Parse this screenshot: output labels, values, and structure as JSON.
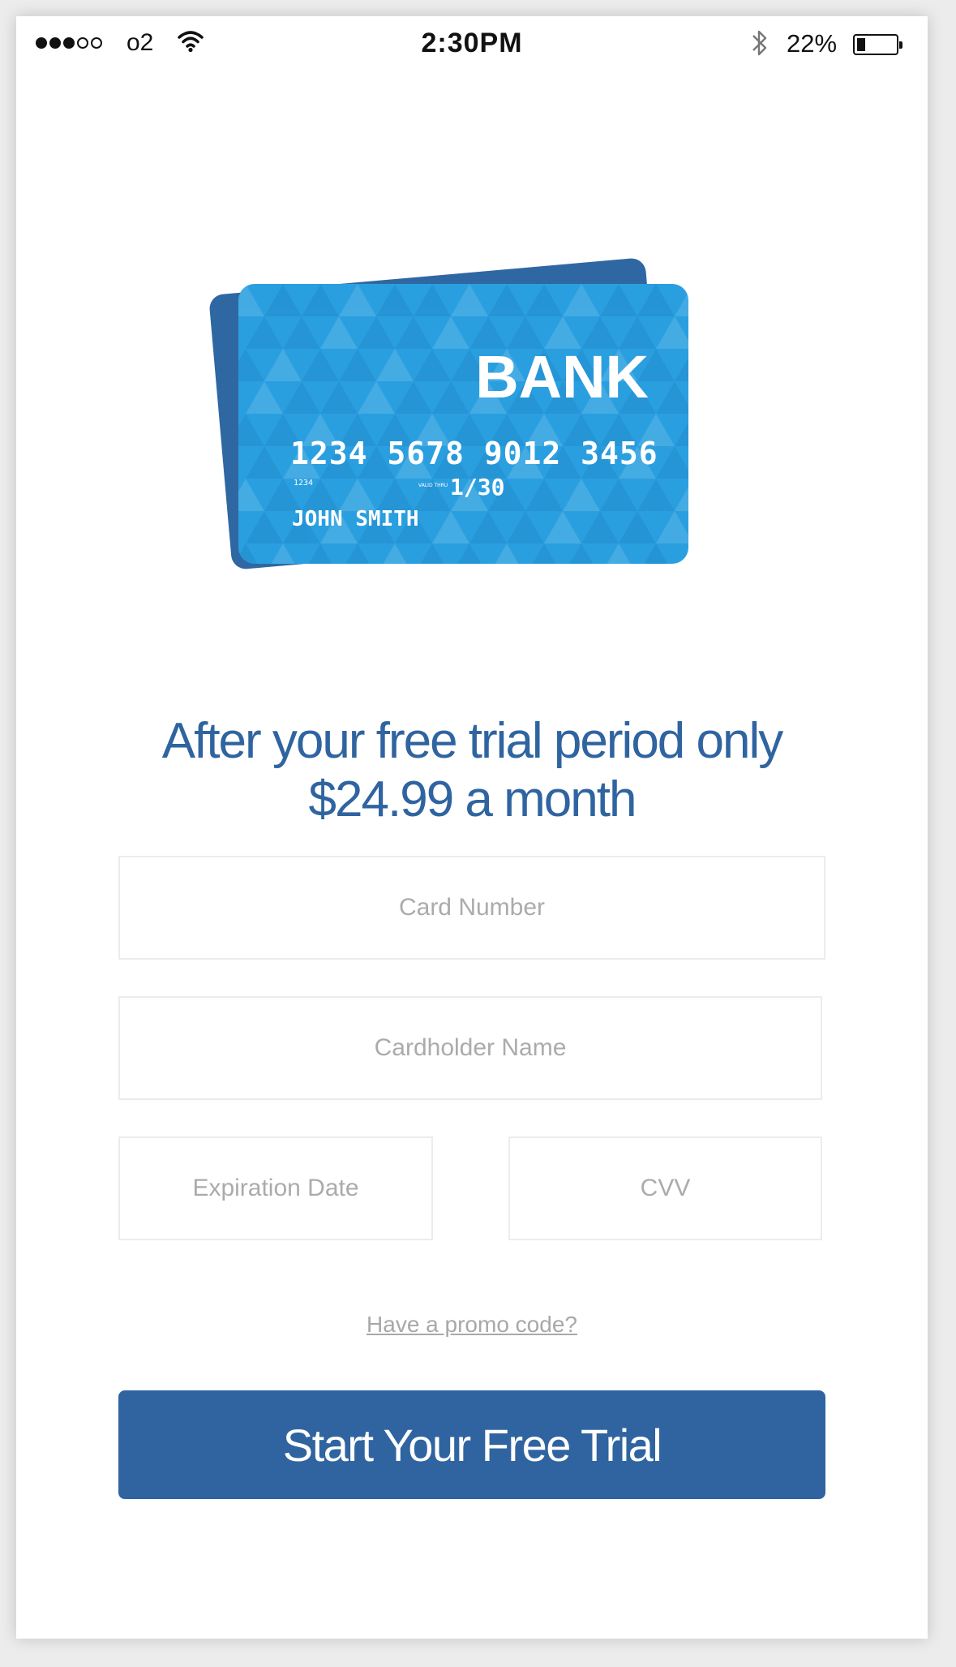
{
  "status_bar": {
    "carrier": "o2",
    "time": "2:30PM",
    "battery_percent": "22%",
    "battery_level": 0.22,
    "signal_bars_filled": 3,
    "signal_bars_total": 5
  },
  "card": {
    "bank_name": "BANK",
    "number": "1234 5678 9012 3456",
    "small_code": "1234",
    "valid_thru_label": "VALID THRU",
    "expiry": "1/30",
    "holder": "JOHN SMITH",
    "colors": {
      "front": "#2a9fe0",
      "back": "#2f67a3"
    }
  },
  "headline": {
    "line1": "After your free trial period only",
    "line2": "$24.99 a month"
  },
  "form": {
    "card_number_placeholder": "Card Number",
    "cardholder_name_placeholder": "Cardholder Name",
    "expiration_date_placeholder": "Expiration Date",
    "cvv_placeholder": "CVV"
  },
  "promo_link": "Have a promo code?",
  "cta_label": "Start Your Free Trial",
  "colors": {
    "accent": "#2f64a0",
    "placeholder": "#a8a8a8"
  },
  "icons": [
    "wifi-icon",
    "bluetooth-icon",
    "battery-icon",
    "signal-dots-icon"
  ]
}
